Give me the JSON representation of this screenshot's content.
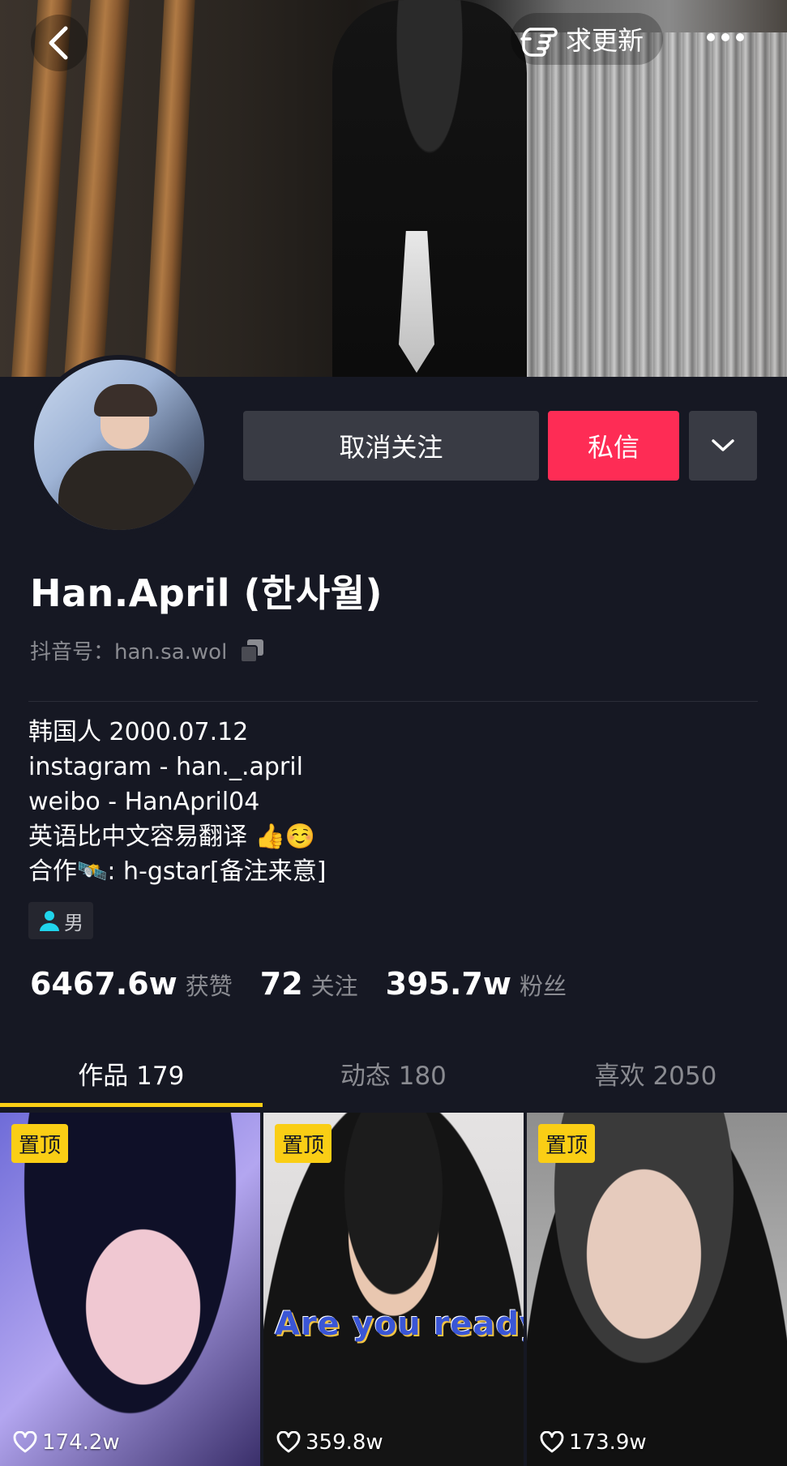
{
  "topbar": {
    "back_icon": "chevron-left-icon",
    "request_update_label": "求更新",
    "request_update_icon": "pointing-hand-icon",
    "more_icon": "more-dots-icon"
  },
  "profile": {
    "name": "Han.April (한사월)",
    "douyin_id": "抖音号：han.sa.wol",
    "copy_icon": "copy-icon",
    "bio_lines": [
      "韩国人 2000.07.12",
      "instagram - han._.april",
      "weibo - HanApril04",
      "英语比中文容易翻译 👍☺️",
      "合作🛰️: h-gstar[备注来意]"
    ],
    "gender": "男",
    "gender_icon": "person-icon"
  },
  "actions": {
    "unfollow_label": "取消关注",
    "message_label": "私信",
    "dropdown_icon": "chevron-down-icon"
  },
  "stats": [
    {
      "value": "6467.6w",
      "label": "获赞"
    },
    {
      "value": "72",
      "label": "关注"
    },
    {
      "value": "395.7w",
      "label": "粉丝"
    }
  ],
  "tabs": [
    {
      "label": "作品 179",
      "active": true
    },
    {
      "label": "动态 180",
      "active": false
    },
    {
      "label": "喜欢 2050",
      "active": false
    }
  ],
  "videos": [
    {
      "badge": "置顶",
      "likes": "174.2w",
      "caption": ""
    },
    {
      "badge": "置顶",
      "likes": "359.8w",
      "caption": "Are you ready?"
    },
    {
      "badge": "置顶",
      "likes": "173.9w",
      "caption": ""
    }
  ],
  "colors": {
    "background": "#161823",
    "accent_red": "#fe2c55",
    "tab_indicator": "#face15",
    "pin_badge": "#face15",
    "gender_icon": "#20d5ec"
  }
}
